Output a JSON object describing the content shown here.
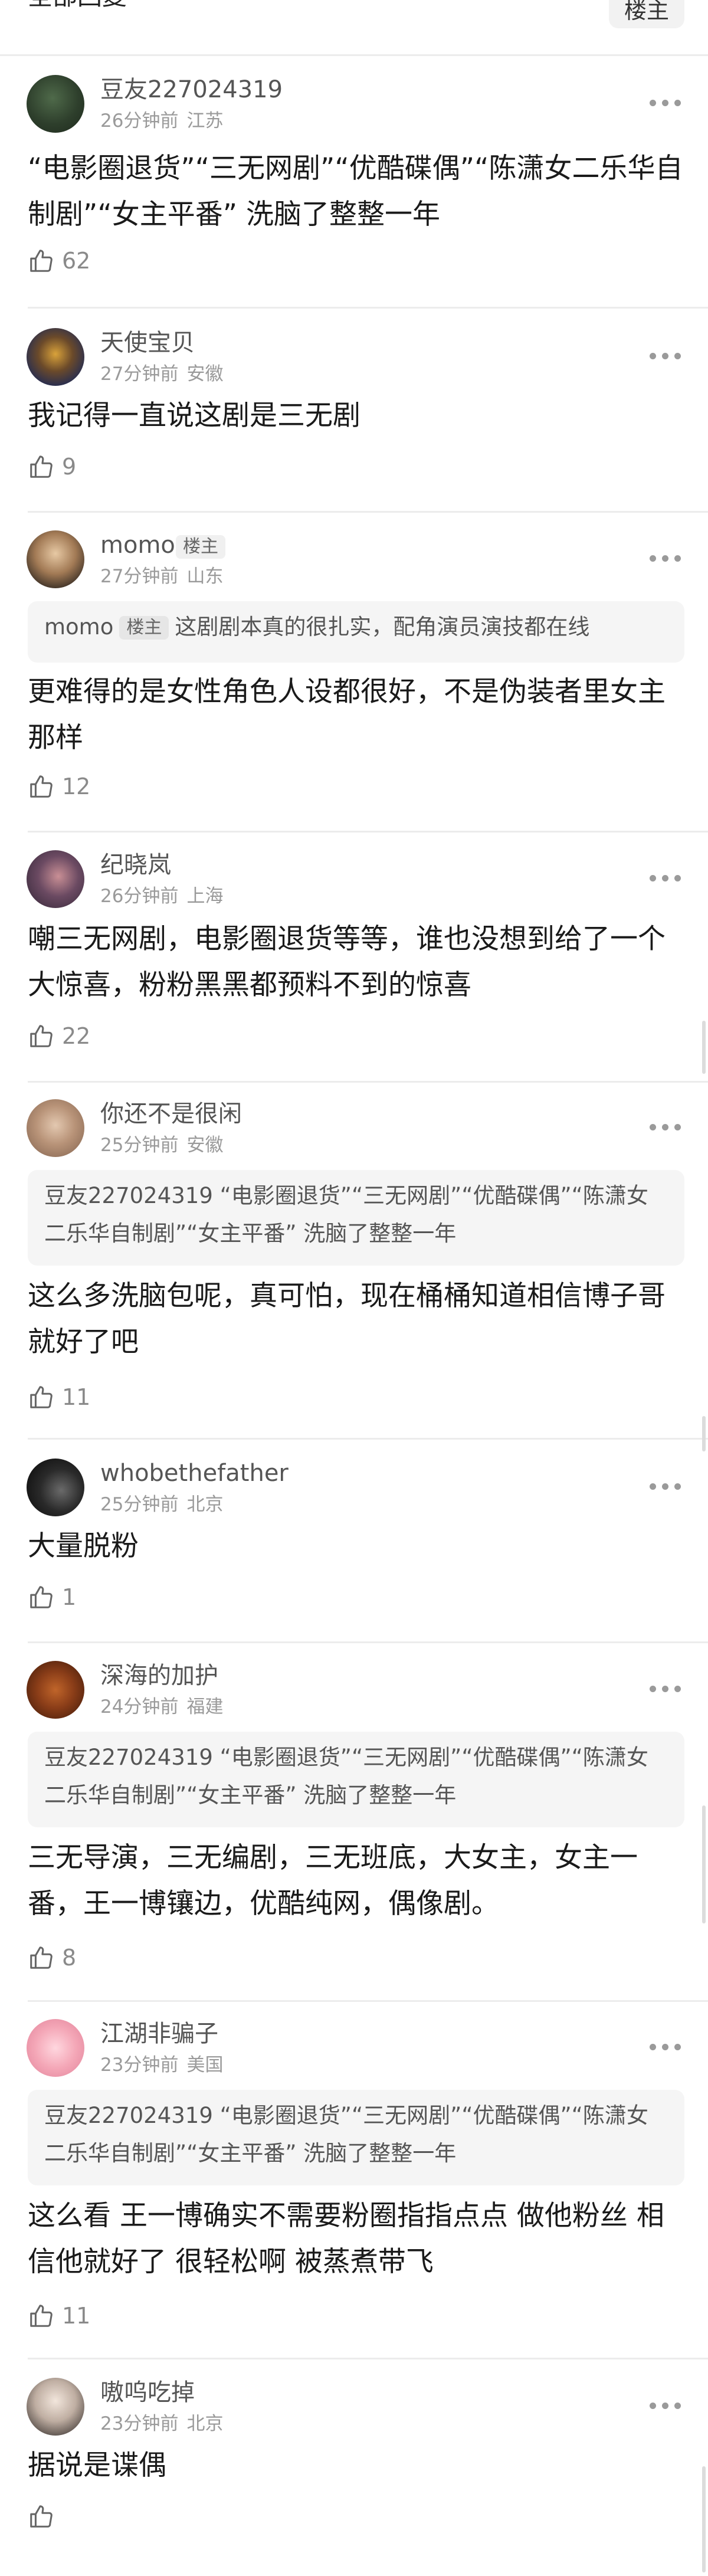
{
  "header": {
    "title": "全部回复",
    "op_button": "楼主"
  },
  "comments": [
    {
      "username": "豆友227024319",
      "time": "26分钟前",
      "location": "江苏",
      "text": "“电影圈退货”“三无网剧”“优酷碟偶”“陈潇女二乐华自制剧”“女主平番” 洗脑了整整一年",
      "likes": "62"
    },
    {
      "username": "天使宝贝",
      "time": "27分钟前",
      "location": "安徽",
      "text": "我记得一直说这剧是三无剧",
      "likes": "9"
    },
    {
      "username": "momo",
      "op_tag": "楼主",
      "time": "27分钟前",
      "location": "山东",
      "quote": {
        "name": "momo",
        "tag": "楼主",
        "text": "这剧剧本真的很扎实，配角演员演技都在线"
      },
      "text": "更难得的是女性角色人设都很好，不是伪装者里女主那样",
      "likes": "12"
    },
    {
      "username": "纪晓岚",
      "time": "26分钟前",
      "location": "上海",
      "text": "嘲三无网剧，电影圈退货等等，谁也没想到给了一个大惊喜，粉粉黑黑都预料不到的惊喜",
      "likes": "22"
    },
    {
      "username": "你还不是很闲",
      "time": "25分钟前",
      "location": "安徽",
      "quote": {
        "name": "豆友227024319",
        "text": "“电影圈退货”“三无网剧”“优酷碟偶”“陈潇女二乐华自制剧”“女主平番” 洗脑了整整一年"
      },
      "text": "这么多洗脑包呢，真可怕，现在桶桶知道相信博子哥就好了吧",
      "likes": "11"
    },
    {
      "username": "whobethefather",
      "time": "25分钟前",
      "location": "北京",
      "text": "大量脱粉",
      "likes": "1"
    },
    {
      "username": "深海的加护",
      "time": "24分钟前",
      "location": "福建",
      "quote": {
        "name": "豆友227024319",
        "text": "“电影圈退货”“三无网剧”“优酷碟偶”“陈潇女二乐华自制剧”“女主平番” 洗脑了整整一年"
      },
      "text": "三无导演，三无编剧，三无班底，大女主，女主一番，王一博镶边，优酷纯网，偶像剧。",
      "likes": "8"
    },
    {
      "username": "江湖非骗子",
      "time": "23分钟前",
      "location": "美国",
      "quote": {
        "name": "豆友227024319",
        "text": "“电影圈退货”“三无网剧”“优酷碟偶”“陈潇女二乐华自制剧”“女主平番” 洗脑了整整一年"
      },
      "text": "这么看 王一博确实不需要粉圈指指点点 做他粉丝 相信他就好了 很轻松啊 被蒸煮带飞",
      "likes": "11"
    },
    {
      "username": "嗷呜吃掉",
      "time": "23分钟前",
      "location": "北京",
      "text": "据说是谍偶",
      "likes": ""
    }
  ],
  "colors": {
    "text": "#1a1a1a",
    "secondary": "#9a9a9a",
    "quote_bg": "#f5f5f5",
    "divider": "#ececec"
  },
  "icons": {
    "like": "thumbs-up-icon",
    "more": "more-dots-icon"
  }
}
